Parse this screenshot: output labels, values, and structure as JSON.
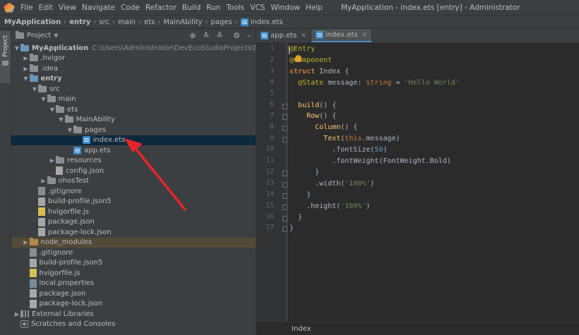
{
  "menu": {
    "items": [
      "File",
      "Edit",
      "View",
      "Navigate",
      "Code",
      "Refactor",
      "Build",
      "Run",
      "Tools",
      "VCS",
      "Window",
      "Help"
    ],
    "window_title": "MyApplication - index.ets [entry] - Administrator"
  },
  "breadcrumbs": [
    "MyApplication",
    "entry",
    "src",
    "main",
    "ets",
    "MainAbility",
    "pages",
    "index.ets"
  ],
  "left_stripe": {
    "project_label": "Project"
  },
  "project_panel": {
    "title": "Project",
    "tree": [
      {
        "label": "MyApplication",
        "hint": "C:\\Users\\Administrator\\DevEcoStudioProjects\\MyApplicati",
        "depth": 0,
        "chevron": "down",
        "icon": "folder-blue",
        "bold": true
      },
      {
        "label": ".hvigor",
        "depth": 1,
        "chevron": "right",
        "icon": "folder"
      },
      {
        "label": ".idea",
        "depth": 1,
        "chevron": "right",
        "icon": "folder"
      },
      {
        "label": "entry",
        "depth": 1,
        "chevron": "down",
        "icon": "folder-blue",
        "bold": true
      },
      {
        "label": "src",
        "depth": 2,
        "chevron": "down",
        "icon": "folder"
      },
      {
        "label": "main",
        "depth": 3,
        "chevron": "down",
        "icon": "folder"
      },
      {
        "label": "ets",
        "depth": 4,
        "chevron": "down",
        "icon": "folder"
      },
      {
        "label": "MainAbility",
        "depth": 5,
        "chevron": "down",
        "icon": "folder"
      },
      {
        "label": "pages",
        "depth": 6,
        "chevron": "down",
        "icon": "folder"
      },
      {
        "label": "index.ets",
        "depth": 7,
        "chevron": "none",
        "icon": "ets",
        "selected": true
      },
      {
        "label": "app.ets",
        "depth": 6,
        "chevron": "none",
        "icon": "ets"
      },
      {
        "label": "resources",
        "depth": 4,
        "chevron": "right",
        "icon": "folder"
      },
      {
        "label": "config.json",
        "depth": 4,
        "chevron": "none",
        "icon": "json"
      },
      {
        "label": "ohosTest",
        "depth": 3,
        "chevron": "right",
        "icon": "folder"
      },
      {
        "label": ".gitignore",
        "depth": 2,
        "chevron": "none",
        "icon": "git"
      },
      {
        "label": "build-profile.json5",
        "depth": 2,
        "chevron": "none",
        "icon": "json"
      },
      {
        "label": "hvigorfile.js",
        "depth": 2,
        "chevron": "none",
        "icon": "js"
      },
      {
        "label": "package.json",
        "depth": 2,
        "chevron": "none",
        "icon": "json"
      },
      {
        "label": "package-lock.json",
        "depth": 2,
        "chevron": "none",
        "icon": "json"
      },
      {
        "label": "node_modules",
        "depth": 1,
        "chevron": "right",
        "icon": "folder-orange",
        "highlight": true
      },
      {
        "label": ".gitignore",
        "depth": 1,
        "chevron": "none",
        "icon": "git"
      },
      {
        "label": "build-profile.json5",
        "depth": 1,
        "chevron": "none",
        "icon": "json"
      },
      {
        "label": "hvigorfile.js",
        "depth": 1,
        "chevron": "none",
        "icon": "js"
      },
      {
        "label": "local.properties",
        "depth": 1,
        "chevron": "none",
        "icon": "props"
      },
      {
        "label": "package.json",
        "depth": 1,
        "chevron": "none",
        "icon": "json"
      },
      {
        "label": "package-lock.json",
        "depth": 1,
        "chevron": "none",
        "icon": "json"
      },
      {
        "label": "External Libraries",
        "depth": 0,
        "chevron": "right",
        "icon": "lib"
      },
      {
        "label": "Scratches and Consoles",
        "depth": 0,
        "chevron": "none",
        "icon": "scratch"
      }
    ]
  },
  "editor": {
    "tabs": [
      {
        "label": "app.ets",
        "active": false
      },
      {
        "label": "index.ets",
        "active": true
      }
    ],
    "line_numbers": [
      "1",
      "2",
      "3",
      "4",
      "5",
      "6",
      "7",
      "8",
      "9",
      "10",
      "11",
      "12",
      "13",
      "14",
      "15",
      "16",
      "17"
    ],
    "code": [
      [
        [
          "dec",
          "@Entry"
        ]
      ],
      [
        [
          "dec",
          "@Component"
        ]
      ],
      [
        [
          "kw",
          "struct "
        ],
        [
          "cls",
          "Index "
        ],
        [
          "id",
          "{"
        ]
      ],
      [
        [
          "id",
          "  "
        ],
        [
          "dec",
          "@State "
        ],
        [
          "id",
          "message: "
        ],
        [
          "kw2",
          "string "
        ],
        [
          "id",
          "= "
        ],
        [
          "str",
          "'Hello World'"
        ]
      ],
      [],
      [
        [
          "id",
          "  "
        ],
        [
          "fn",
          "build"
        ],
        [
          "id",
          "() {"
        ]
      ],
      [
        [
          "id",
          "    "
        ],
        [
          "fn",
          "Row"
        ],
        [
          "id",
          "() {"
        ]
      ],
      [
        [
          "id",
          "      "
        ],
        [
          "fn",
          "Column"
        ],
        [
          "id",
          "() {"
        ]
      ],
      [
        [
          "id",
          "        "
        ],
        [
          "fn",
          "Text"
        ],
        [
          "id",
          "("
        ],
        [
          "this",
          "this"
        ],
        [
          "id",
          ".message)"
        ]
      ],
      [
        [
          "id",
          "          ."
        ],
        [
          "id",
          "fontSize("
        ],
        [
          "num",
          "50"
        ],
        [
          "id",
          ")"
        ]
      ],
      [
        [
          "id",
          "          ."
        ],
        [
          "id",
          "fontWeight(FontWeight.Bold)"
        ]
      ],
      [
        [
          "id",
          "      }"
        ]
      ],
      [
        [
          "id",
          "      ."
        ],
        [
          "id",
          "width("
        ],
        [
          "str",
          "'100%'"
        ],
        [
          "id",
          ")"
        ]
      ],
      [
        [
          "id",
          "    }"
        ]
      ],
      [
        [
          "id",
          "    ."
        ],
        [
          "id",
          "height("
        ],
        [
          "str",
          "'100%'"
        ],
        [
          "id",
          ")"
        ]
      ],
      [
        [
          "id",
          "  }"
        ]
      ],
      [
        [
          "id",
          "}"
        ]
      ]
    ],
    "status": "Index"
  }
}
